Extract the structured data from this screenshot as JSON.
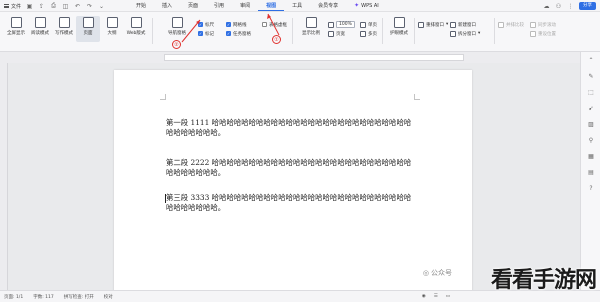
{
  "menubar": {
    "file_label": "文件",
    "tabs": [
      {
        "label": "开始",
        "active": false
      },
      {
        "label": "插入",
        "active": false
      },
      {
        "label": "页面",
        "active": false
      },
      {
        "label": "引用",
        "active": false
      },
      {
        "label": "审阅",
        "active": false
      },
      {
        "label": "视图",
        "active": true
      },
      {
        "label": "工具",
        "active": false
      },
      {
        "label": "会员专享",
        "active": false
      },
      {
        "label": "WPS AI",
        "active": false
      }
    ],
    "share_label": "分享",
    "accent_color": "#2f6fe4"
  },
  "ribbon": {
    "views": [
      {
        "label": "全屏显示",
        "icon": "fullscreen-icon"
      },
      {
        "label": "阅读模式",
        "icon": "read-mode-icon"
      },
      {
        "label": "写作模式",
        "icon": "write-mode-icon"
      },
      {
        "label": "页面",
        "icon": "page-view-icon",
        "selected": true
      },
      {
        "label": "大纲",
        "icon": "outline-icon"
      },
      {
        "label": "Web版式",
        "icon": "web-layout-icon"
      }
    ],
    "nav_pane_label": "导航窗格",
    "checks": [
      {
        "label": "标尺",
        "checked": true
      },
      {
        "label": "网格线",
        "checked": true
      },
      {
        "label": "表格虚框",
        "checked": false
      },
      {
        "label": "标记",
        "checked": true
      },
      {
        "label": "任务窗格",
        "checked": true
      }
    ],
    "zoom": {
      "show_ratio": "显示比例",
      "percent": "100%",
      "one_page": "单页",
      "multi_page": "多页",
      "page_width": "页宽"
    },
    "eye_mode": "护眼模式",
    "window": {
      "rearrange": "重排窗口",
      "new_window": "新建窗口",
      "split_window": "拆分窗口"
    },
    "sync": {
      "side_by_side": "并排比较",
      "sync_scroll": "同步滚动",
      "reset_position": "重设位置"
    },
    "annotations": {
      "circle_1": "①",
      "circle_2": "②",
      "color": "#e0322f"
    }
  },
  "document": {
    "paragraphs": [
      "第一段 1111 哈哈哈哈哈哈哈哈哈哈哈哈哈哈哈哈哈哈哈哈哈哈哈哈哈哈哈哈哈哈哈哈哈哈。",
      "第二段 2222 哈哈哈哈哈哈哈哈哈哈哈哈哈哈哈哈哈哈哈哈哈哈哈哈哈哈哈哈哈哈哈哈哈哈。",
      "第三段 3333 哈哈哈哈哈哈哈哈哈哈哈哈哈哈哈哈哈哈哈哈哈哈哈哈哈哈哈哈哈哈哈哈哈哈。"
    ]
  },
  "status": {
    "page": "页面: 1/1",
    "words": "字数: 117",
    "spell": "拼写检查: 打开",
    "proofread": "校对"
  },
  "watermark": {
    "small": "公众号",
    "big": "看看手游网"
  }
}
